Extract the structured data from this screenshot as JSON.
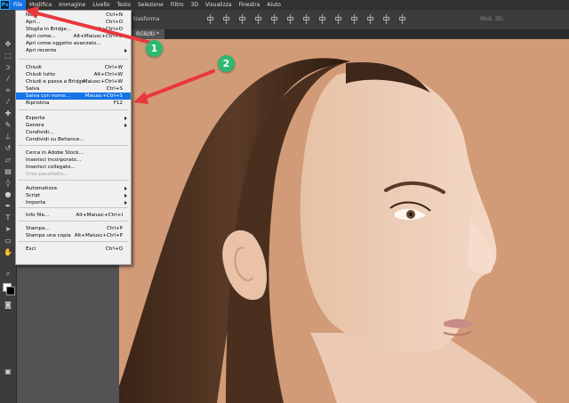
{
  "menubar": {
    "app_icon": "Ps",
    "items": [
      "File",
      "Modifica",
      "Immagine",
      "Livello",
      "Testo",
      "Selezione",
      "Filtro",
      "3D",
      "Visualizza",
      "Finestra",
      "Aiuto"
    ]
  },
  "optionsbar": {
    "transform_label": "trasforma",
    "mode3d_label": "Mod. 3D:"
  },
  "tab": {
    "title": "RGB/8) *"
  },
  "file_menu": {
    "items": [
      {
        "label": "Nuovo...",
        "shortcut": "Ctrl+N"
      },
      {
        "label": "Apri...",
        "shortcut": "Ctrl+O"
      },
      {
        "label": "Sfoglia in Bridge...",
        "shortcut": "Alt+Ctrl+O"
      },
      {
        "label": "Apri come...",
        "shortcut": "Alt+Maiusc+Ctrl+O"
      },
      {
        "label": "Apri come oggetto avanzato...",
        "shortcut": ""
      },
      {
        "label": "Apri recente",
        "shortcut": "",
        "submenu": true
      },
      {
        "label": "Chiudi",
        "shortcut": "Ctrl+W"
      },
      {
        "label": "Chiudi tutto",
        "shortcut": "Alt+Ctrl+W"
      },
      {
        "label": "Chiudi e passa a Bridge...",
        "shortcut": "Maiusc+Ctrl+W"
      },
      {
        "label": "Salva",
        "shortcut": "Ctrl+S"
      },
      {
        "label": "Salva con nome...",
        "shortcut": "Maiusc+Ctrl+S",
        "highlighted": true
      },
      {
        "label": "Ripristina",
        "shortcut": "F12"
      },
      {
        "label": "Esporta",
        "shortcut": "",
        "submenu": true
      },
      {
        "label": "Genera",
        "shortcut": "",
        "submenu": true
      },
      {
        "label": "Condividi...",
        "shortcut": ""
      },
      {
        "label": "Condividi su Behance...",
        "shortcut": ""
      },
      {
        "label": "Cerca in Adobe Stock...",
        "shortcut": ""
      },
      {
        "label": "Inserisci incorporato...",
        "shortcut": ""
      },
      {
        "label": "Inserisci collegato...",
        "shortcut": ""
      },
      {
        "label": "Crea pacchetto...",
        "shortcut": "",
        "disabled": true
      },
      {
        "label": "Automatizza",
        "shortcut": "",
        "submenu": true
      },
      {
        "label": "Script",
        "shortcut": "",
        "submenu": true
      },
      {
        "label": "Importa",
        "shortcut": "",
        "submenu": true
      },
      {
        "label": "Info file...",
        "shortcut": "Alt+Maiusc+Ctrl+I"
      },
      {
        "label": "Stampa...",
        "shortcut": "Ctrl+P"
      },
      {
        "label": "Stampa una copia",
        "shortcut": "Alt+Maiusc+Ctrl+P"
      },
      {
        "label": "Esci",
        "shortcut": "Ctrl+Q"
      }
    ]
  },
  "annotations": {
    "badge1": "1",
    "badge2": "2",
    "arrow_color": "#e8383d",
    "badge_color": "#2fb86f"
  },
  "toolbar_icons": [
    "move-icon",
    "marquee-icon",
    "lasso-icon",
    "magic-wand-icon",
    "crop-icon",
    "eyedropper-icon",
    "healing-brush-icon",
    "brush-icon",
    "clone-stamp-icon",
    "history-brush-icon",
    "eraser-icon",
    "gradient-icon",
    "blur-icon",
    "dodge-icon",
    "pen-icon",
    "type-icon",
    "path-select-icon",
    "rectangle-icon",
    "hand-icon",
    "zoom-icon"
  ]
}
